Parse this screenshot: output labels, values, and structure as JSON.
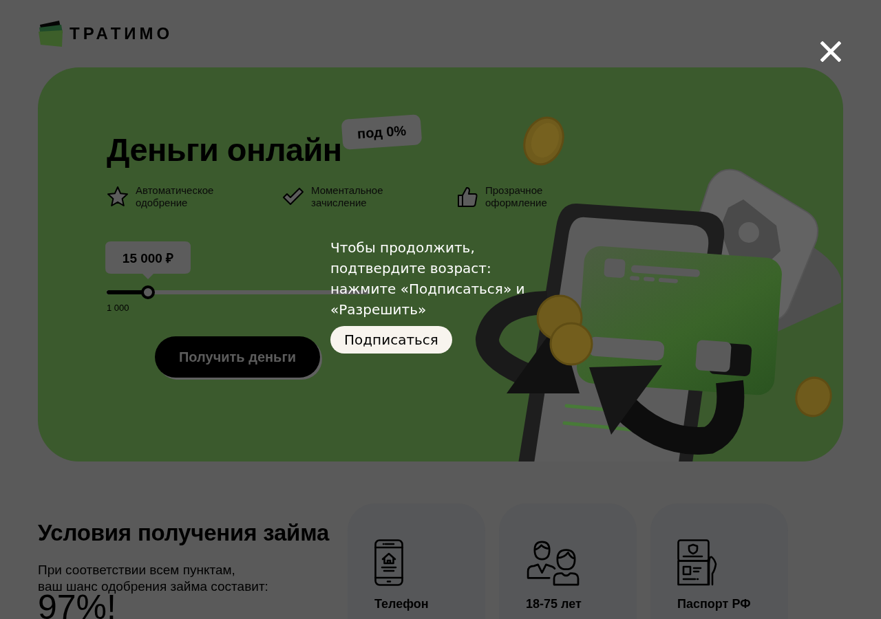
{
  "logo": {
    "name": "ТРАТИМО"
  },
  "hero": {
    "title": "Деньги онлайн",
    "badge": "под 0%",
    "features": [
      {
        "kind": "star",
        "text": "Автоматическое\nодобрение"
      },
      {
        "kind": "check",
        "text": "Моментальное\nзачисление"
      },
      {
        "kind": "thumb",
        "text": "Прозрачное\nоформление"
      }
    ],
    "slider": {
      "value": "15 000 ₽",
      "level": 0.158,
      "min_label": "1 000"
    },
    "cta_button": "Получить деньги"
  },
  "subscribe_prompt": {
    "message": "Чтобы продолжить,\nподтвердите возраст:\nнажмите «Подписаться» и\n«Разрешить»",
    "button": "Подписаться"
  },
  "conditions": {
    "title": "Условия получения займа",
    "description": "При соответствии всем пунктам,\nваш шанс одобрения займа составит:",
    "chance": "97%!",
    "requirements": [
      {
        "kind": "phone",
        "label": "Телефон"
      },
      {
        "kind": "people",
        "label": "18-75 лет"
      },
      {
        "kind": "passport",
        "label": "Паспорт РФ"
      }
    ]
  }
}
